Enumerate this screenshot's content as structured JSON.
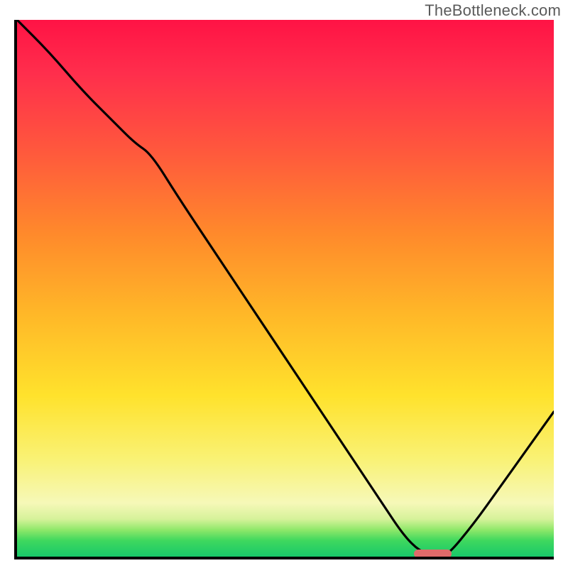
{
  "watermark": "TheBottleneck.com",
  "colors": {
    "gradient_top": "#ff1345",
    "gradient_mid": "#ffe22c",
    "gradient_bottom": "#18c96a",
    "curve": "#000000",
    "marker": "#e06a6a",
    "axis": "#000000"
  },
  "chart_data": {
    "type": "line",
    "title": "",
    "xlabel": "",
    "ylabel": "",
    "xlim": [
      0,
      100
    ],
    "ylim": [
      0,
      100
    ],
    "grid": false,
    "series": [
      {
        "name": "bottleneck-curve",
        "x": [
          0,
          6,
          12,
          18,
          22,
          25,
          30,
          38,
          46,
          54,
          62,
          68,
          72,
          75,
          78,
          80,
          85,
          90,
          95,
          100
        ],
        "values": [
          100,
          94,
          87,
          81,
          77,
          75,
          67,
          55,
          43,
          31,
          19,
          10,
          4,
          1,
          0,
          0,
          6,
          13,
          20,
          27
        ]
      }
    ],
    "marker": {
      "name": "optimal-range",
      "x_start": 74,
      "x_end": 81,
      "y": 0.5
    },
    "background": {
      "type": "vertical-gradient",
      "description": "y-value mapped to color: high=red (bad), mid=yellow, low=green (good)"
    }
  }
}
